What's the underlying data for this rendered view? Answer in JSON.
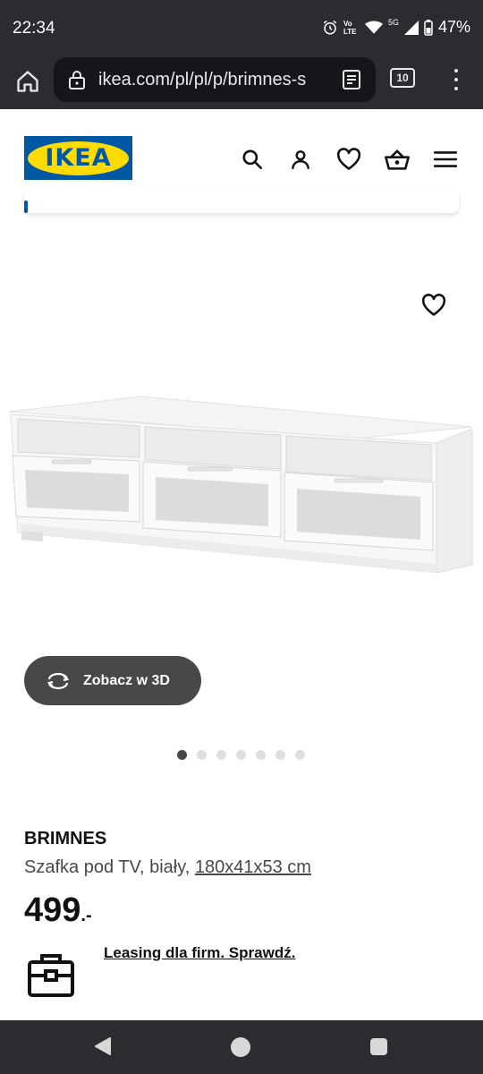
{
  "status_bar": {
    "time": "22:34",
    "battery": "47%",
    "network": "5G",
    "volte": "Vo LTE",
    "icons": [
      "alarm-icon",
      "volte-icon",
      "wifi-icon",
      "signal-icon",
      "battery-icon"
    ]
  },
  "browser": {
    "url": "ikea.com/pl/pl/p/brimnes-s",
    "tab_count": "10",
    "icons": [
      "home-icon",
      "lock-icon",
      "reader-mode-icon",
      "menu-dots-icon"
    ]
  },
  "site_header": {
    "logo_text": "IKEA",
    "icons": [
      "search-icon",
      "user-icon",
      "heart-icon",
      "basket-icon",
      "hamburger-menu-icon"
    ]
  },
  "product": {
    "view_3d_label": "Zobacz w 3D",
    "gallery": {
      "total_images": 7,
      "active_index": 0
    },
    "name": "BRIMNES",
    "description": "Szafka pod TV, biały,",
    "dimensions": "180x41x53 cm",
    "price": "499",
    "price_suffix": ".-",
    "leasing_link": "Leasing dla firm. Sprawdź."
  },
  "colors": {
    "brand_blue": "#0058a3",
    "brand_yellow": "#ffdb00",
    "dark_button": "#484848",
    "system_bar": "#2b2b30"
  }
}
